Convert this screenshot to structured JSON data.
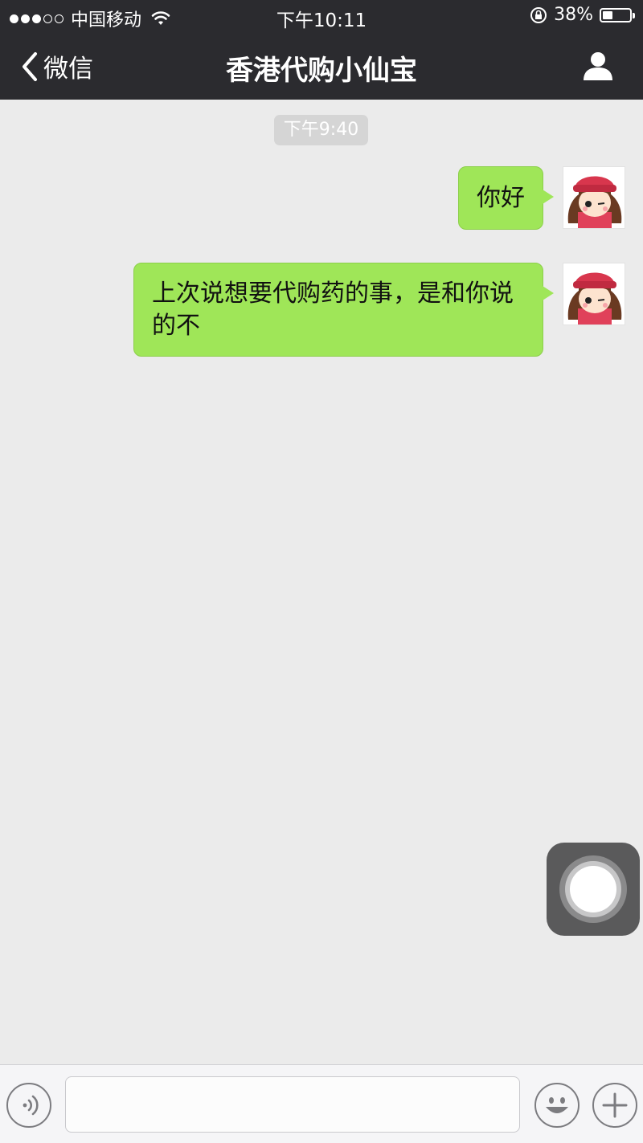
{
  "status_bar": {
    "signal_bars_filled": 3,
    "signal_bars_total": 5,
    "carrier": "中国移动",
    "time": "下午10:11",
    "battery_text": "38%",
    "battery_level": 0.38,
    "icons": [
      "wifi-icon",
      "orientation-lock-icon",
      "battery-icon"
    ]
  },
  "nav": {
    "back_label": "微信",
    "title": "香港代购小仙宝",
    "back_icon": "chevron-left-icon",
    "profile_icon": "person-icon"
  },
  "chat": {
    "timestamp": "下午9:40",
    "messages": [
      {
        "sender": "me",
        "text": "你好"
      },
      {
        "sender": "me",
        "text": "上次说想要代购药的事，是和你说的不"
      }
    ]
  },
  "input_bar": {
    "voice_icon": "voice-icon",
    "emoji_icon": "emoji-icon",
    "more_icon": "plus-icon",
    "text_value": ""
  },
  "colors": {
    "header_bg": "#2b2b2f",
    "chat_bg": "#ebebeb",
    "bubble_green": "#9fe658",
    "timestamp_bg": "#d5d5d5"
  }
}
